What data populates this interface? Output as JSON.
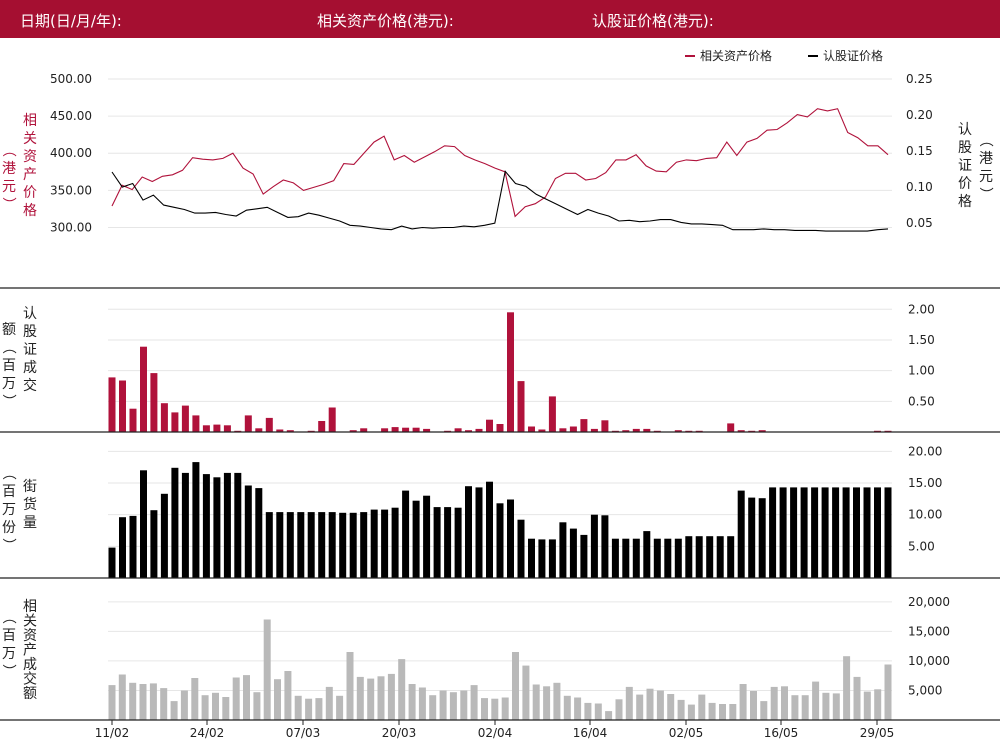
{
  "header": {
    "date_label": "日期(日/月/年):",
    "asset_price_label": "相关资产价格(港元):",
    "warrant_price_label": "认股证价格(港元):"
  },
  "colors": {
    "header_bg": "#a50f31",
    "asset": "#b0123b",
    "warrant": "#000000",
    "asset_volume": "#b9b9b9"
  },
  "chart_data": [
    {
      "type": "line",
      "legend": [
        "相关资产价格",
        "认股证价格"
      ],
      "legend_position": "top-right",
      "ylabel_left": "相关资产价格（港元）",
      "ylabel_right": "认股证价格（港元）",
      "yticks_left": [
        "300.00",
        "350.00",
        "400.00",
        "450.00",
        "500.00"
      ],
      "yticks_right": [
        "0.05",
        "0.10",
        "0.15",
        "0.20",
        "0.25"
      ],
      "ylim_left": [
        267,
        500
      ],
      "ylim_right": [
        0.01,
        0.25
      ],
      "series": [
        {
          "name": "相关资产价格",
          "axis": "left",
          "values": [
            329,
            357,
            351,
            368,
            362,
            369,
            371,
            377,
            394,
            392,
            391,
            393,
            400,
            380,
            372,
            345,
            355,
            364,
            360,
            350,
            354,
            358,
            363,
            386,
            385,
            400,
            415,
            423,
            391,
            397,
            388,
            395,
            402,
            410,
            409,
            397,
            391,
            386,
            380,
            375,
            315,
            328,
            332,
            341,
            366,
            373,
            373,
            364,
            366,
            374,
            391,
            391,
            398,
            383,
            376,
            375,
            388,
            391,
            390,
            393,
            394,
            415,
            397,
            415,
            420,
            431,
            432,
            441,
            452,
            449,
            460,
            457,
            460,
            428,
            421,
            410,
            410,
            398
          ]
        },
        {
          "name": "认股证价格",
          "axis": "right",
          "values": [
            0.121,
            0.1,
            0.105,
            0.082,
            0.089,
            0.075,
            0.072,
            0.069,
            0.064,
            0.064,
            0.065,
            0.062,
            0.06,
            0.068,
            0.07,
            0.072,
            0.065,
            0.058,
            0.059,
            0.064,
            0.061,
            0.057,
            0.053,
            0.047,
            0.046,
            0.044,
            0.042,
            0.041,
            0.046,
            0.042,
            0.044,
            0.043,
            0.044,
            0.044,
            0.046,
            0.045,
            0.047,
            0.05,
            0.122,
            0.105,
            0.101,
            0.09,
            0.083,
            0.076,
            0.069,
            0.062,
            0.069,
            0.064,
            0.06,
            0.053,
            0.054,
            0.052,
            0.053,
            0.055,
            0.055,
            0.051,
            0.049,
            0.049,
            0.048,
            0.047,
            0.041,
            0.041,
            0.041,
            0.042,
            0.041,
            0.041,
            0.04,
            0.04,
            0.04,
            0.039,
            0.039,
            0.039,
            0.039,
            0.039,
            0.041,
            0.042
          ]
        }
      ]
    },
    {
      "type": "bar",
      "ylabel": "认股证成交额（百万）",
      "yticks": [
        "0.50",
        "1.00",
        "1.50",
        "2.00"
      ],
      "ylim": [
        0,
        2.2
      ],
      "series": [
        {
          "name": "认股证成交额",
          "values": [
            0.89,
            0.84,
            0.38,
            1.39,
            0.96,
            0.47,
            0.32,
            0.43,
            0.27,
            0.11,
            0.12,
            0.11,
            0.02,
            0.27,
            0.06,
            0.23,
            0.04,
            0.03,
            0,
            0.02,
            0.18,
            0.4,
            0,
            0.03,
            0.06,
            0,
            0.06,
            0.08,
            0.07,
            0.07,
            0.05,
            0,
            0.02,
            0.06,
            0.03,
            0.05,
            0.2,
            0.13,
            1.95,
            0.83,
            0.09,
            0.04,
            0.58,
            0.06,
            0.09,
            0.21,
            0.05,
            0.19,
            0.02,
            0.03,
            0.05,
            0.05,
            0.02,
            0,
            0.03,
            0.02,
            0.02,
            0,
            0,
            0.14,
            0.03,
            0.02,
            0.03,
            0,
            0,
            0,
            0,
            0,
            0,
            0,
            0,
            0,
            0,
            0.02,
            0.02
          ]
        }
      ]
    },
    {
      "type": "bar",
      "ylabel": "街货量（百万份）",
      "yticks": [
        "5.00",
        "10.00",
        "15.00",
        "20.00"
      ],
      "ylim": [
        0,
        21
      ],
      "series": [
        {
          "name": "街货量",
          "values": [
            4.8,
            9.6,
            9.8,
            17.0,
            10.7,
            13.3,
            17.4,
            16.6,
            18.3,
            16.4,
            15.9,
            16.6,
            16.6,
            14.6,
            14.2,
            10.4,
            10.4,
            10.4,
            10.4,
            10.4,
            10.4,
            10.4,
            10.3,
            10.3,
            10.4,
            10.8,
            10.8,
            11.1,
            13.8,
            12.2,
            13.0,
            11.2,
            11.2,
            11.1,
            14.5,
            14.3,
            15.2,
            11.8,
            12.4,
            9.2,
            6.2,
            6.1,
            6.1,
            8.8,
            7.8,
            6.8,
            10.0,
            9.9,
            6.2,
            6.2,
            6.2,
            7.4,
            6.2,
            6.2,
            6.2,
            6.6,
            6.6,
            6.6,
            6.6,
            6.6,
            13.8,
            12.7,
            12.6,
            14.3,
            14.3,
            14.3,
            14.3,
            14.3,
            14.3,
            14.3,
            14.3,
            14.3,
            14.3,
            14.3,
            14.3
          ]
        }
      ]
    },
    {
      "type": "bar",
      "ylabel": "相关资产成交额（百万）",
      "yticks": [
        "5,000",
        "10,000",
        "15,000",
        "20,000"
      ],
      "ylim": [
        0,
        22000
      ],
      "series": [
        {
          "name": "相关资产成交额",
          "values": [
            5900,
            7700,
            6300,
            6100,
            6200,
            5400,
            3200,
            5000,
            7100,
            4200,
            4600,
            3900,
            7200,
            7600,
            4700,
            17000,
            6900,
            8300,
            4100,
            3600,
            3700,
            5600,
            4100,
            11500,
            7300,
            7000,
            7400,
            7800,
            10300,
            6100,
            5500,
            4200,
            5000,
            4700,
            5000,
            5900,
            3700,
            3600,
            3800,
            11500,
            9200,
            6000,
            5700,
            6300,
            4100,
            3800,
            2900,
            2800,
            1500,
            3500,
            5600,
            4300,
            5300,
            5000,
            4400,
            3400,
            2600,
            4300,
            2900,
            2700,
            2700,
            6100,
            4900,
            3200,
            5600,
            5700,
            4200,
            4200,
            6500,
            4600,
            4500,
            10800,
            7300,
            4800,
            5200,
            9400
          ]
        }
      ]
    }
  ],
  "x_axis": {
    "ticks": [
      "11/02",
      "24/02",
      "07/03",
      "20/03",
      "02/04",
      "16/04",
      "02/05",
      "16/05",
      "29/05"
    ]
  }
}
